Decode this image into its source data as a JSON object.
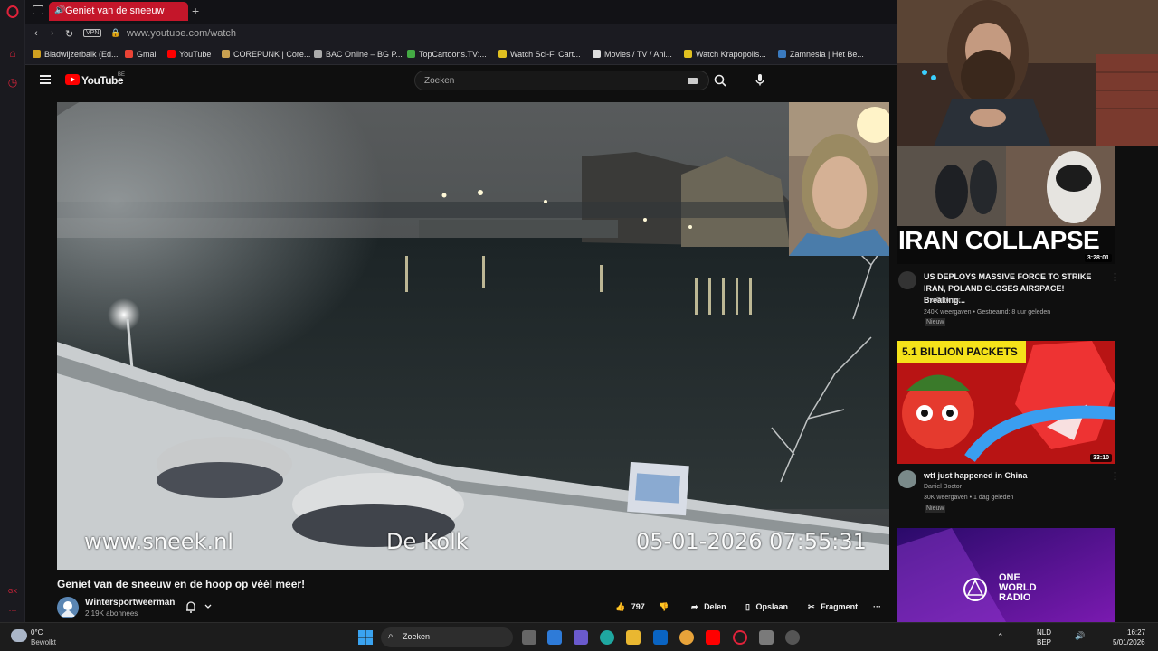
{
  "browser": {
    "tab_title": "Geniet van de sneeuw",
    "url": "www.youtube.com/watch",
    "vpn_label": "VPN",
    "bookmarks": [
      {
        "label": "Bladwijzerbalk (Ed...",
        "color": "#d0a020"
      },
      {
        "label": "Gmail",
        "color": "#ea4335"
      },
      {
        "label": "YouTube",
        "color": "#ff0000"
      },
      {
        "label": "COREPUNK | Core...",
        "color": "#c8a050"
      },
      {
        "label": "BAC Online – BG P...",
        "color": "#aaaaaa"
      },
      {
        "label": "TopCartoons.TV:...",
        "color": "#44aa44"
      },
      {
        "label": "Watch Sci-Fi Cart...",
        "color": "#e0c020"
      },
      {
        "label": "Movies / TV / Ani...",
        "color": "#dddddd"
      },
      {
        "label": "Watch Krapopolis...",
        "color": "#e0c020"
      },
      {
        "label": "Zamnesia | Het Be...",
        "color": "#3a7abf"
      }
    ]
  },
  "youtube": {
    "logo_text": "YouTube",
    "country_code": "BE",
    "search_placeholder": "Zoeken"
  },
  "video": {
    "watermark_site": "www.sneek.nl",
    "watermark_place": "De Kolk",
    "watermark_timestamp": "05-01-2026 07:55:31",
    "title": "Geniet van de sneeuw en de hoop op véél meer!",
    "channel": "Wintersportweerman",
    "subscribers": "2,19K abonnees",
    "likes": "797",
    "share_label": "Delen",
    "save_label": "Opslaan",
    "clip_label": "Fragment"
  },
  "recommendations": [
    {
      "thumb_text": "IRAN COLLAPSE",
      "duration": "3:28:01",
      "title": "US DEPLOYS MASSIVE FORCE TO STRIKE IRAN, POLAND CLOSES AIRSPACE! Breaking...",
      "channel": "The Enforcer",
      "meta": "240K weergaven • Gestreamd: 8 uur geleden",
      "badge": "Nieuw"
    },
    {
      "thumb_text": "5.1 BILLION PACKETS",
      "duration": "33:10",
      "title": "wtf just happened in China",
      "channel": "Daniel Boctor",
      "meta": "30K weergaven • 1 dag geleden",
      "badge": "Nieuw"
    },
    {
      "thumb_text": "ONE WORLD RADIO"
    }
  ],
  "taskbar": {
    "weather_temp": "0°C",
    "weather_desc": "Bewolkt",
    "search_label": "Zoeken",
    "lang_top": "NLD",
    "lang_bottom": "BEP",
    "time": "16:27",
    "date": "5/01/2026"
  },
  "colors": {
    "opera_red": "#c4162a",
    "youtube_red": "#ff0000",
    "bg": "#0f0f0f"
  }
}
